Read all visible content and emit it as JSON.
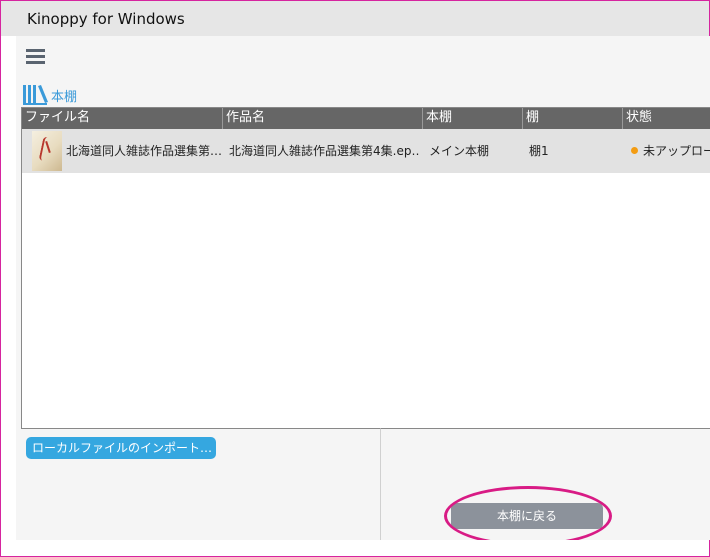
{
  "window": {
    "title": "Kinoppy for Windows"
  },
  "nav": {
    "menu_icon": "hamburger-menu-icon",
    "shelf_tab_label": "本棚",
    "shelf_icon": "bookshelf-icon"
  },
  "table": {
    "columns": [
      "ファイル名",
      "作品名",
      "本棚",
      "棚",
      "状態"
    ],
    "rows": [
      {
        "file_name": "北海道同人雑誌作品選集第…",
        "title": "北海道同人雑誌作品選集第4集.ep…",
        "bookshelf": "メイン本棚",
        "shelf": "棚1",
        "status": "未アップロー",
        "status_color": "#f39c12"
      }
    ]
  },
  "buttons": {
    "import_local": "ローカルファイルのインポート…",
    "back_to_shelf": "本棚に戻る"
  },
  "colors": {
    "accent": "#3a9ad9",
    "header_bg": "#666666",
    "highlight": "#d81b85"
  }
}
